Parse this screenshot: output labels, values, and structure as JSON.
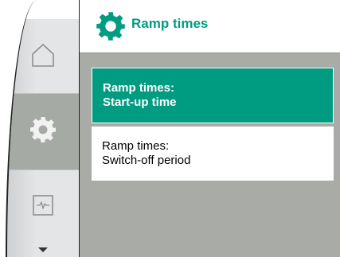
{
  "header": {
    "title": "Ramp times",
    "icon": "settings-gear-icon",
    "accent_color": "#009c82"
  },
  "nav": {
    "items": [
      {
        "name": "home",
        "icon": "home-icon",
        "selected": false
      },
      {
        "name": "settings",
        "icon": "gear-icon",
        "selected": true
      },
      {
        "name": "diagnostics",
        "icon": "pulse-monitor-icon",
        "selected": false
      }
    ],
    "more_icon": "chevron-down-icon"
  },
  "menu": {
    "options": [
      {
        "line1": "Ramp times:",
        "line2": "Start-up time",
        "selected": true
      },
      {
        "line1": "Ramp times:",
        "line2": "Switch-off period",
        "selected": false
      }
    ]
  }
}
